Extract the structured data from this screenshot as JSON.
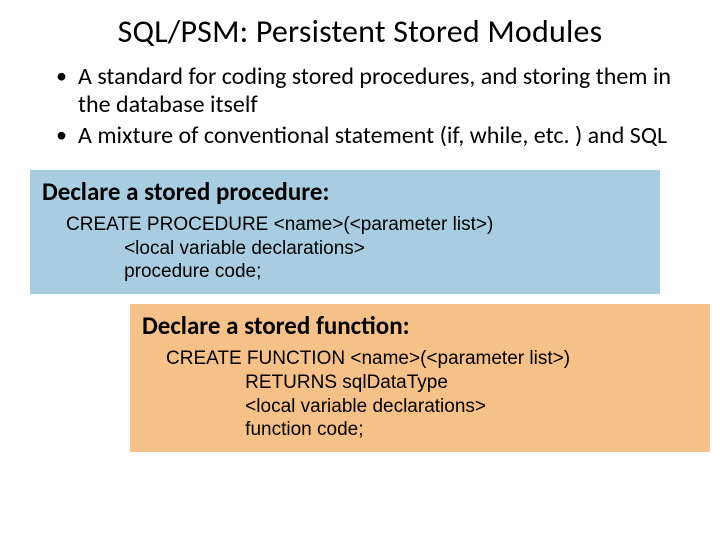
{
  "title": "SQL/PSM:  Persistent Stored Modules",
  "bullets": [
    "A standard for coding stored procedures, and storing them in the database itself",
    "A mixture of conventional statement (if, while, etc. ) and SQL"
  ],
  "proc": {
    "heading": "Declare a stored procedure:",
    "code": "CREATE PROCEDURE <name>(<parameter list>)\n           <local variable declarations>\n           procedure code;"
  },
  "func": {
    "heading": "Declare a stored function:",
    "code": "CREATE FUNCTION <name>(<parameter list>)\n               RETURNS sqlDataType\n               <local variable declarations>\n               function code;"
  }
}
